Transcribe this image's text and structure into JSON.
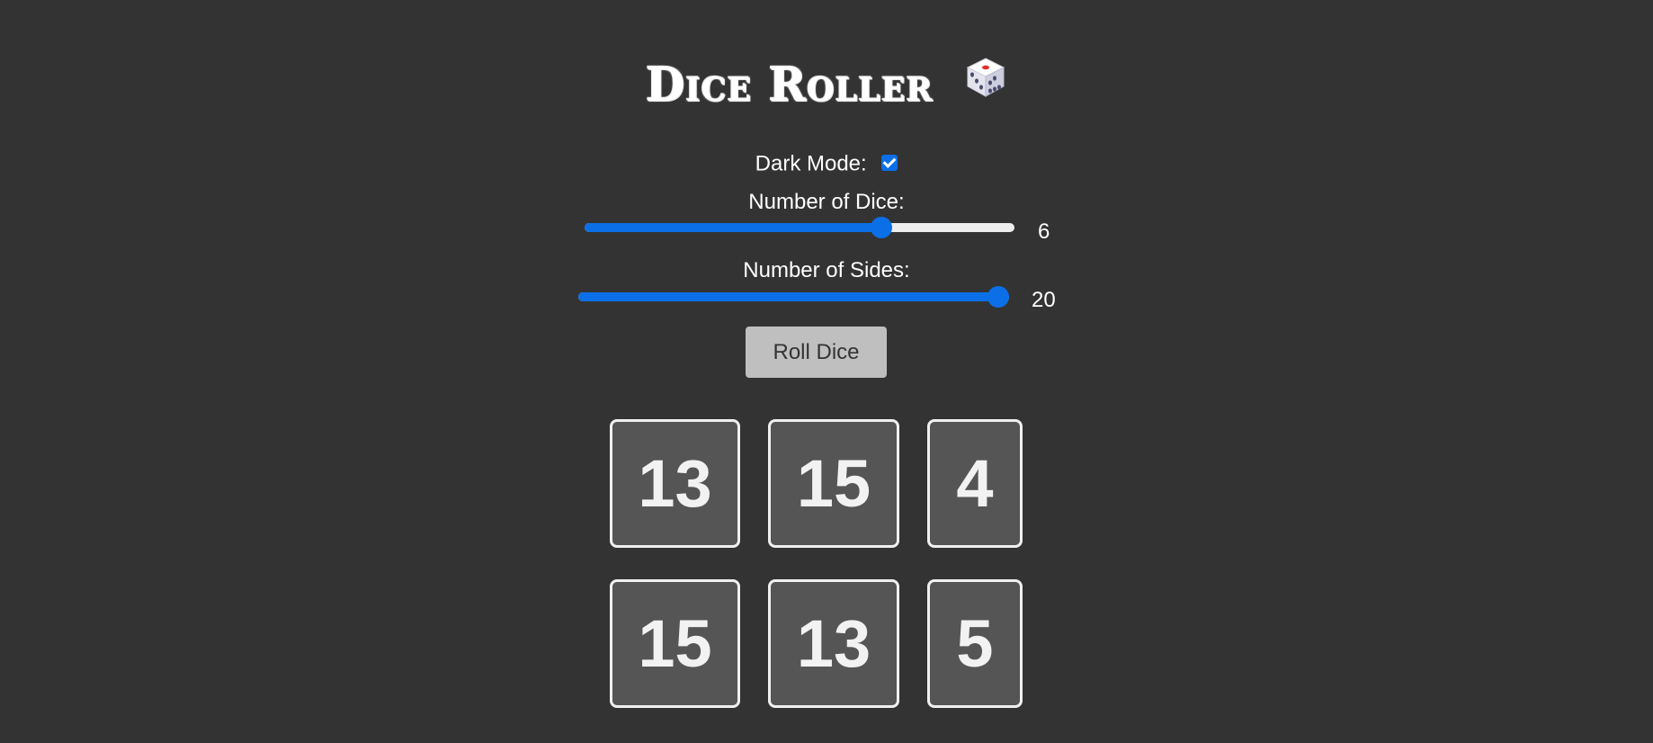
{
  "title": {
    "text": "Dice Roller",
    "icon": "game-die-icon"
  },
  "dark_mode": {
    "label": "Dark Mode:",
    "checked": true
  },
  "dice_slider": {
    "label": "Number of Dice:",
    "value": "6",
    "fraction": 0.7
  },
  "sides_slider": {
    "label": "Number of Sides:",
    "value": "20",
    "fraction": 1.0
  },
  "roll_button": {
    "label": "Roll Dice"
  },
  "dice": [
    {
      "value": "13"
    },
    {
      "value": "15"
    },
    {
      "value": "4"
    },
    {
      "value": "15"
    },
    {
      "value": "13"
    },
    {
      "value": "5"
    }
  ],
  "colors": {
    "background": "#333333",
    "accent": "#0b6fe8",
    "die_face": "#555555",
    "die_border": "#f0f0f0",
    "button": "#bfbfbf"
  }
}
